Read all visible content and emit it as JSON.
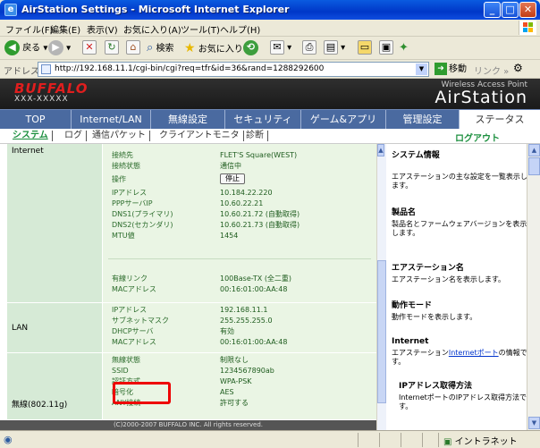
{
  "window": {
    "title": "AirStation Settings - Microsoft Internet Explorer",
    "min": "_",
    "max": "□",
    "close": "✕"
  },
  "menu": [
    "ファイル(F)",
    "編集(E)",
    "表示(V)",
    "お気に入り(A)",
    "ツール(T)",
    "ヘルプ(H)"
  ],
  "toolbar": {
    "back": "戻る",
    "search": "検索",
    "favorites": "お気に入り"
  },
  "address": {
    "label": "アドレス(D)",
    "url": "http://192.168.11.1/cgi-bin/cgi?req=tfr&id=36&rand=1288292600",
    "go": "移動",
    "links": "リンク »"
  },
  "header": {
    "logo": "BUFFALO",
    "model": "XXX-XXXXX",
    "tagline": "Wireless Access Point",
    "product": "AirStation"
  },
  "nav": [
    "TOP",
    "Internet/LAN",
    "無線設定",
    "セキュリティ",
    "ゲーム&アプリ",
    "管理設定",
    "ステータス"
  ],
  "subnav": [
    "システム",
    "ログ",
    "通信パケット",
    "クライアントモニタ",
    "診断"
  ],
  "logout": "ログアウト",
  "sections": {
    "internet": {
      "title": "Internet",
      "rows": [
        {
          "k": "接続先",
          "v": "FLET'S Square(WEST)"
        },
        {
          "k": "接続状態",
          "v": "通信中"
        },
        {
          "k": "操作",
          "v": "停止"
        },
        {
          "k": "IPアドレス",
          "v": "10.184.22.220"
        },
        {
          "k": "PPPサーバIP",
          "v": "10.60.22.21"
        },
        {
          "k": "DNS1(プライマリ)",
          "v": "10.60.21.72 (自動取得)"
        },
        {
          "k": "DNS2(セカンダリ)",
          "v": "10.60.21.73 (自動取得)"
        },
        {
          "k": "MTU値",
          "v": "1454"
        },
        {
          "k": "有線リンク",
          "v": "100Base-TX (全二重)"
        },
        {
          "k": "MACアドレス",
          "v": "00:16:01:00:AA:48"
        }
      ]
    },
    "lan": {
      "title": "LAN",
      "rows": [
        {
          "k": "IPアドレス",
          "v": "192.168.11.1"
        },
        {
          "k": "サブネットマスク",
          "v": "255.255.255.0"
        },
        {
          "k": "DHCPサーバ",
          "v": "有効"
        },
        {
          "k": "MACアドレス",
          "v": "00:16:01:00:AA:48"
        }
      ]
    },
    "wireless": {
      "title": "無線(802.11g)",
      "rows": [
        {
          "k": "無線状態",
          "v": "制限なし"
        },
        {
          "k": "SSID",
          "v": "1234567890ab"
        },
        {
          "k": "認証方式",
          "v": "WPA-PSK"
        },
        {
          "k": "暗号化",
          "v": "AES"
        },
        {
          "k": "ANY接続",
          "v": "許可する"
        }
      ]
    }
  },
  "footer": "(C)2000-2007 BUFFALO INC. All rights reserved.",
  "sidebar": [
    {
      "title": "システム情報",
      "text": "エアステーションの主な設定を一覧表示します。"
    },
    {
      "title": "製品名",
      "text": "製品名とファームウェアバージョンを表示します。"
    },
    {
      "title": "エアステーション名",
      "text": "エアステーション名を表示します。"
    },
    {
      "title": "動作モード",
      "text": "動作モードを表示します。"
    },
    {
      "title": "Internet",
      "text_pre": "エアステーション",
      "link": "Internetポート",
      "text_post": "の情報です。"
    },
    {
      "title": "IPアドレス取得方法",
      "text": "InternetポートのIPアドレス取得方法です。"
    }
  ],
  "status": {
    "zone": "イントラネット"
  }
}
